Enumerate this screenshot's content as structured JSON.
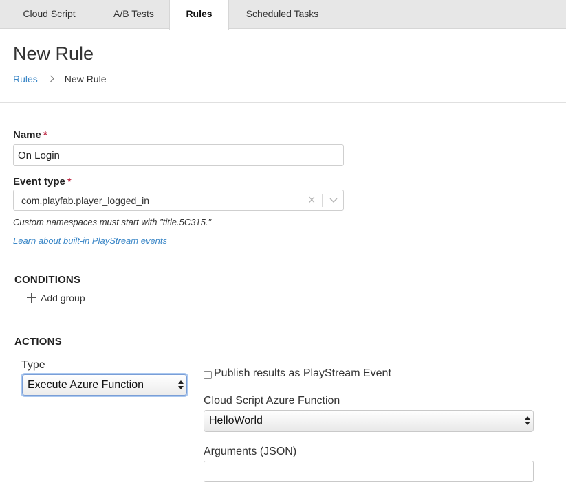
{
  "tabs": [
    {
      "label": "Cloud Script"
    },
    {
      "label": "A/B Tests"
    },
    {
      "label": "Rules"
    },
    {
      "label": "Scheduled Tasks"
    }
  ],
  "header": {
    "title": "New Rule",
    "breadcrumb": {
      "link": "Rules",
      "current": "New Rule"
    }
  },
  "form": {
    "name": {
      "label": "Name",
      "required_mark": "*",
      "value": "On Login"
    },
    "event_type": {
      "label": "Event type",
      "required_mark": "*",
      "value": "com.playfab.player_logged_in",
      "clear_glyph": "×",
      "hint": "Custom namespaces must start with \"title.5C315.\"",
      "learn_link": "Learn about built-in PlayStream events"
    }
  },
  "conditions": {
    "heading": "CONDITIONS",
    "add_group_label": "Add group"
  },
  "actions": {
    "heading": "ACTIONS",
    "type_label": "Type",
    "type_value": "Execute Azure Function",
    "publish_label": "Publish results as PlayStream Event",
    "publish_checked": false,
    "function_label": "Cloud Script Azure Function",
    "function_value": "HelloWorld",
    "arguments_label": "Arguments (JSON)",
    "arguments_value": ""
  },
  "colors": {
    "link": "#3b87c7",
    "required": "#c0304a",
    "tabbar": "#e7e7e7"
  }
}
